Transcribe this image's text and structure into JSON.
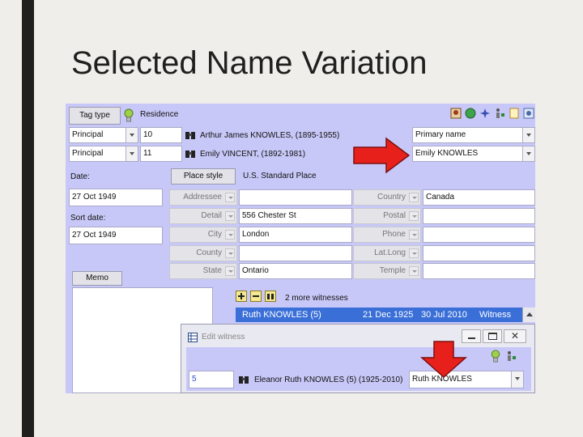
{
  "slide": {
    "title": "Selected Name Variation"
  },
  "toolbar": {
    "tag_type_label": "Tag type",
    "tag_name": "Residence"
  },
  "principals": [
    {
      "role": "Principal",
      "id": "10",
      "name": "Arthur James KNOWLES, (1895-1955)",
      "name_variation": "Primary name"
    },
    {
      "role": "Principal",
      "id": "11",
      "name": "Emily VINCENT, (1892-1981)",
      "name_variation": "Emily KNOWLES"
    }
  ],
  "date": {
    "label": "Date:",
    "value": "27 Oct 1949",
    "sort_label": "Sort date:",
    "sort_value": "27 Oct 1949"
  },
  "place": {
    "style_button": "Place style",
    "style_value": "U.S. Standard Place"
  },
  "address_fields": {
    "addressee": "Addressee",
    "detail": "Detail",
    "detail_value": "556 Chester St",
    "city": "City",
    "city_value": "London",
    "county": "County",
    "state": "State",
    "state_value": "Ontario"
  },
  "right_fields": {
    "country": "Country",
    "country_value": "Canada",
    "postal": "Postal",
    "phone": "Phone",
    "latlong": "Lat.Long",
    "temple": "Temple"
  },
  "memo": {
    "label": "Memo"
  },
  "witnesses": {
    "more_label": "2 more witnesses",
    "row": {
      "name": "Ruth KNOWLES (5)",
      "date1": "21 Dec 1925",
      "date2": "30 Jul 2010",
      "role": "Witness"
    }
  },
  "edit_witness": {
    "title": "Edit witness",
    "id": "5",
    "name": "Eleanor Ruth KNOWLES (5) (1925-2010)",
    "name_variation": "Ruth KNOWLES"
  },
  "colors": {
    "accent_arrow": "#e8201c",
    "selection": "#3a6fd8",
    "form_bg": "#c8c8f8"
  }
}
